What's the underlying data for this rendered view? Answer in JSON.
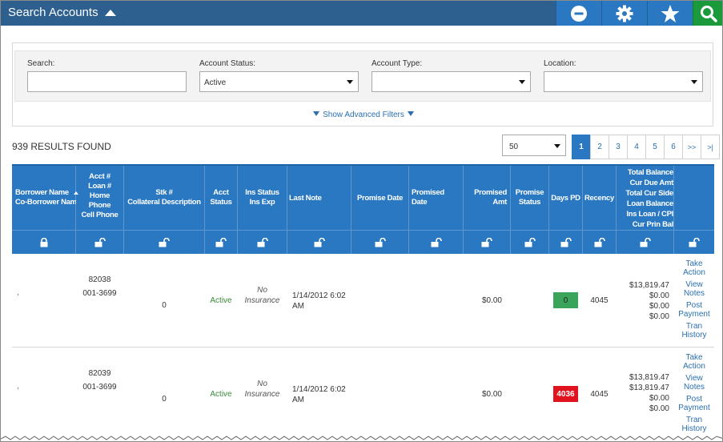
{
  "header": {
    "title": "Search Accounts"
  },
  "toolbar": {
    "icons": [
      "minus-circle-icon",
      "gear-icon",
      "star-icon",
      "search-icon"
    ],
    "colors": {
      "bar": "#2d5f8f",
      "button": "#2a78c2",
      "search_button": "#1a9a3a"
    }
  },
  "filters": {
    "search_label": "Search:",
    "search_value": "",
    "status_label": "Account Status:",
    "status_value": "Active",
    "type_label": "Account Type:",
    "type_value": "",
    "location_label": "Location:",
    "location_value": "",
    "advanced_label": "Show Advanced Filters"
  },
  "results": {
    "count_text": "939 RESULTS FOUND",
    "page_size": "50",
    "pages": [
      "1",
      "2",
      "3",
      "4",
      "5",
      "6",
      ">>",
      ">|"
    ],
    "current_page": "1"
  },
  "table": {
    "headers": {
      "borrower": "Borrower Name\nCo-Borrower Nam",
      "acct": "Acct #\nLoan #\nHome\nPhone\nCell Phone",
      "stk": "Stk #\nCollateral Description",
      "acct_status": "Acct\nStatus",
      "ins_status": "Ins Status\nIns Exp",
      "last_note": "Last Note",
      "promise_date": "Promise Date",
      "promised_date": "Promised\nDate",
      "promised_amt": "Promised\nAmt",
      "promise_status": "Promise\nStatus",
      "days_pd": "Days PD",
      "recency": "Recency",
      "balance": "Total Balance\nCur Due Amt\nTotal Cur Side\nLoan Balance\nIns Loan / CPI\nCur Prin Bal"
    },
    "rows": [
      {
        "borrower": ",",
        "acct": "82038",
        "loan": "001-3699",
        "stk": "0",
        "status": "Active",
        "ins": "No\nInsurance",
        "last_note": "1/14/2012 6:02\nAM",
        "promised_amt": "$0.00",
        "days_pd": "0",
        "days_color": "#3aa55a",
        "recency": "4045",
        "balances": "$13,819.47\n$0.00\n$0.00\n$0.00",
        "actions": [
          "Take Action",
          "View Notes",
          "Post Payment",
          "Tran History"
        ]
      },
      {
        "borrower": ",",
        "acct": "82039",
        "loan": "001-3699",
        "stk": "0",
        "status": "Active",
        "ins": "No\nInsurance",
        "last_note": "1/14/2012 6:02\nAM",
        "promised_amt": "$0.00",
        "days_pd": "4036",
        "days_color": "#e0141e",
        "recency": "4045",
        "balances": "$13,819.47\n$13,819.47\n$0.00\n$0.00",
        "actions": [
          "Take Action",
          "View Notes",
          "Post Payment",
          "Tran History"
        ]
      }
    ]
  }
}
